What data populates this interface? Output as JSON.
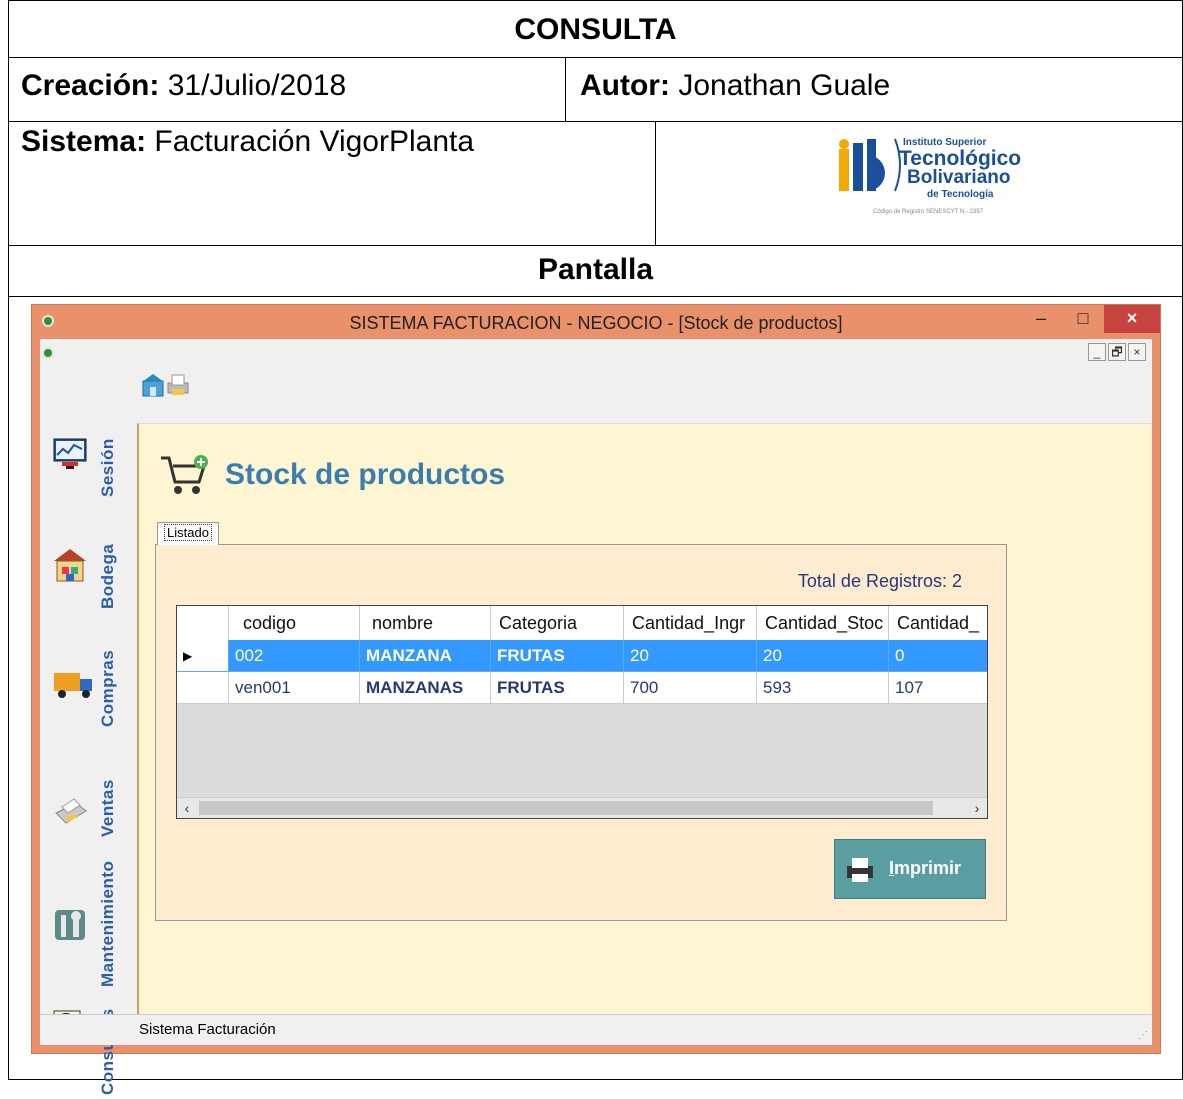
{
  "document": {
    "header_title": "CONSULTA",
    "creacion_label": "Creación:",
    "creacion_value": "31/Julio/2018",
    "autor_label": "Autor:",
    "autor_value": "Jonathan Guale",
    "sistema_label": "Sistema:",
    "sistema_value": "Facturación VigorPlanta",
    "logo": {
      "line1": "Instituto Superior",
      "line2": "Tecnológico",
      "line3": "Bolivariano",
      "line4": "de Tecnología",
      "line5": "Código de Registro SENESCYT N.- 2397"
    },
    "section_title": "Pantalla"
  },
  "window": {
    "title": "SISTEMA FACTURACION - NEGOCIO - [Stock de productos]",
    "minimize": "–",
    "maximize": "□",
    "close": "×",
    "mdi_minimize": "_",
    "mdi_restore": "🗗",
    "mdi_close": "×"
  },
  "sidebar": {
    "items": [
      {
        "label": "Sesión",
        "icon": "session-monitor-icon"
      },
      {
        "label": "Bodega",
        "icon": "warehouse-icon"
      },
      {
        "label": "Compras",
        "icon": "truck-icon"
      },
      {
        "label": "Ventas",
        "icon": "printer-icon"
      },
      {
        "label": "Mantenimiento",
        "icon": "tools-icon"
      },
      {
        "label": "Consultas",
        "icon": "magnifier-icon"
      }
    ]
  },
  "main": {
    "heading": "Stock de productos",
    "tab_label": "Listado",
    "total_label": "Total de Registros: 2",
    "columns": [
      "codigo",
      "nombre",
      "Categoria",
      "Cantidad_Ingr",
      "Cantidad_Stoc",
      "Cantidad_"
    ],
    "rows": [
      {
        "codigo": "002",
        "nombre": "MANZANA",
        "categoria": "FRUTAS",
        "ingreso": "20",
        "stock": "20",
        "cantidad": "0"
      },
      {
        "codigo": "ven001",
        "nombre": "MANZANAS",
        "categoria": "FRUTAS",
        "ingreso": "700",
        "stock": "593",
        "cantidad": "107"
      }
    ],
    "print_label_first": "I",
    "print_label_rest": "mprimir",
    "scroll_left": "‹",
    "scroll_right": "›"
  },
  "status_bar": {
    "text": "Sistema Facturación"
  },
  "colors": {
    "window_border": "#e8916a",
    "content_bg": "#fef6d2",
    "selection": "#3399ff",
    "heading": "#3c7db0",
    "side_label": "#2a5db0",
    "print_button": "#5a9ea2"
  }
}
